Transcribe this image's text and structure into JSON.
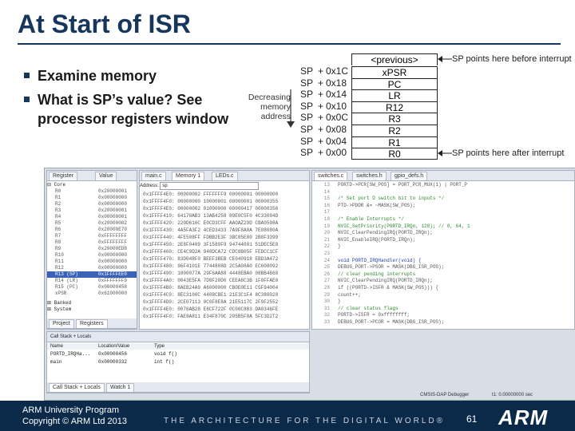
{
  "slide": {
    "title": "At Start of ISR",
    "bullets": [
      "Examine memory",
      "What is SP’s value? See",
      "processor registers window"
    ]
  },
  "stack_diagram": {
    "direction_label_1": "Decreasing",
    "direction_label_2": "memory",
    "direction_label_3": "address",
    "previous": "<previous>",
    "rows": [
      {
        "sp": "SP",
        "plus": "+",
        "offset": "0x1C",
        "content": "xPSR"
      },
      {
        "sp": "SP",
        "plus": "+",
        "offset": "0x18",
        "content": "PC"
      },
      {
        "sp": "SP",
        "plus": "+",
        "offset": "0x14",
        "content": "LR"
      },
      {
        "sp": "SP",
        "plus": "+",
        "offset": "0x10",
        "content": "R12"
      },
      {
        "sp": "SP",
        "plus": "+",
        "offset": "0x0C",
        "content": "R3"
      },
      {
        "sp": "SP",
        "plus": "+",
        "offset": "0x08",
        "content": "R2"
      },
      {
        "sp": "SP",
        "plus": "+",
        "offset": "0x04",
        "content": "R1"
      },
      {
        "sp": "SP",
        "plus": "+",
        "offset": "0x00",
        "content": "R0"
      }
    ],
    "note_before": "SP points here before interrupt",
    "note_after": "SP points here after interrupt"
  },
  "screenshot": {
    "registers_tab": "Register",
    "value_tab": "Value",
    "group_core": "Core",
    "registers": [
      {
        "name": "R0",
        "value": "0x20000001"
      },
      {
        "name": "R1",
        "value": "0x00000000"
      },
      {
        "name": "R2",
        "value": "0x00000000"
      },
      {
        "name": "R3",
        "value": "0x20000001"
      },
      {
        "name": "R4",
        "value": "0x00000001"
      },
      {
        "name": "R5",
        "value": "0x20000002"
      },
      {
        "name": "R6",
        "value": "0x20000E70"
      },
      {
        "name": "R7",
        "value": "0xFFFFFFFF"
      },
      {
        "name": "R8",
        "value": "0xFFFFFFFF"
      },
      {
        "name": "R9",
        "value": "0x20000ED8"
      },
      {
        "name": "R10",
        "value": "0x00000000"
      },
      {
        "name": "R11",
        "value": "0x00000000"
      },
      {
        "name": "R12",
        "value": "0x00000000"
      },
      {
        "name": "R13 (SP)",
        "value": "0x1FFFFEE0"
      },
      {
        "name": "R14 (LR)",
        "value": "0xFFFFFFF9"
      },
      {
        "name": "R15 (PC)",
        "value": "0x00000458"
      },
      {
        "name": "xPSR",
        "value": "0x61000000"
      }
    ],
    "group_banked": "Banked",
    "group_system": "System",
    "project_tab": "Project",
    "registers_bottom_tab": "Registers",
    "memory_tabs": [
      "main.c",
      "Memory 1",
      "LEDs.c"
    ],
    "address_label": "Address:",
    "address_value": "sp",
    "memory_rows": [
      "0x1FFFF4E0: 00000002 FFFFFFF9 00000001 00000000",
      "0x1FFFF4F0: 00000000 10000001 00000001 00000355",
      "0x1FFFF4E0: 00000002 01000000 00000417 00000356",
      "0x1FFFF410: 64170AB3 13AB4258 89E0C5F0 4C33094D",
      "0x1FFFF420: 220D616C E0CD3CFF AAOAZ29D CBA0598A",
      "0x1FFFF430: 4A5FA3F2 4CED3433 7A9F8A0A 7E08080A",
      "0x1FFFF440: 4FE508FF FDBB2E3F 3BC85E80 2B8F3399",
      "0x1FFFF450: 2E8F0409 3F1589F9 94744001 51DEC5E8",
      "0x1FFFF460: CE4C9D2A 948DCA72 CDC8B05F FEDCC1CF",
      "0x1FFFF470: 83D048F0 BEEF3BEB CE040918 EBD3A472",
      "0x1FFFF480: 96F4101E 7744808D 2C5A08A0 EC608092",
      "0x1FFFF490: 1000077A 29F6AA88 4448EBA0 08BB4668",
      "0x1FFFF4A0: 0043E5FA 7D8F20D0 CEEA8C3B 1F0FFAE0",
      "0x1FFFF4B0: 8AEB24A9 A6000000 CB0E0E11 C5F94004",
      "0x1FFFF4C0: 8EC3100C 4408CBE1 21E3C1F4 8C380020",
      "0x1FFFF4D0: 2CE07113 0C0F8E8A 21E5117C 2F9F2552",
      "0x1FFFF4E0: 0076AB28 E8CF722F 0C06C883 DA0346FE",
      "0x1FFFF4F0: FAE8A811 E34F870C 205B5F8A 5FC3D2T2"
    ],
    "code_tabs": [
      "switches.c",
      "switches.h",
      "gpio_defs.h"
    ],
    "code_lines": [
      {
        "no": "13",
        "text": "PORTD->PCR[SW_POS] = PORT_PCR_MUX(1) | PORT_P"
      },
      {
        "no": "14",
        "text": ""
      },
      {
        "no": "15",
        "text": "/* Set port D switch bit to inputs */"
      },
      {
        "no": "16",
        "text": "PTD->PDDR &= ~MASK(SW_POS);"
      },
      {
        "no": "17",
        "text": ""
      },
      {
        "no": "18",
        "text": "/* Enable Interrupts */"
      },
      {
        "no": "19",
        "text": "NVIC_SetPriority(PORTD_IRQn, 128); // 0, 64, 1"
      },
      {
        "no": "20",
        "text": "NVIC_ClearPendingIRQ(PORTD_IRQn);"
      },
      {
        "no": "21",
        "text": "NVIC_EnableIRQ(PORTD_IRQn);"
      },
      {
        "no": "22",
        "text": "}"
      },
      {
        "no": "23",
        "text": ""
      },
      {
        "no": "24",
        "text": "void PORTD_IRQHandler(void) {"
      },
      {
        "no": "25",
        "text": "  DEBUG_PORT->PSOR = MASK(DBG_ISR_POS);"
      },
      {
        "no": "26",
        "text": "  // clear pending interrupts"
      },
      {
        "no": "27",
        "text": "  NVIC_ClearPendingIRQ(PORTD_IRQn);"
      },
      {
        "no": "28",
        "text": "  if ((PORTD->ISFR & MASK(SW_POS))) {"
      },
      {
        "no": "29",
        "text": "    count++;"
      },
      {
        "no": "30",
        "text": "  }"
      },
      {
        "no": "31",
        "text": "  // clear status flags"
      },
      {
        "no": "32",
        "text": "  PORTD->ISFR = 0xffffffff;"
      },
      {
        "no": "33",
        "text": "  DEBUG_PORT->PCOR = MASK(DBG_ISR_POS);"
      }
    ],
    "callstack_title": "Call Stack + Locals",
    "callstack_headers": [
      "Name",
      "Location/Value",
      "Type"
    ],
    "callstack_rows": [
      {
        "name": "PORTD_IRQHa...",
        "location": "0x00000456",
        "type": "void f()"
      },
      {
        "name": "main",
        "location": "0x00000332",
        "type": "int f()"
      }
    ],
    "callstack_tabs": [
      "Call Stack + Locals",
      "Watch 1"
    ],
    "status_debugger": "CMSIS-DAP Debugger",
    "status_time": "t1: 0.00000000 sec"
  },
  "footer": {
    "line1": "ARM University Program",
    "line2": "Copyright © ARM Ltd 2013",
    "tagline": "THE ARCHITECTURE FOR THE DIGITAL WORLD®",
    "page": "61",
    "logo": "ARM"
  },
  "colors": {
    "title": "#16365c",
    "footer": "#0b2a4a",
    "highlight": "#3a63b8"
  }
}
